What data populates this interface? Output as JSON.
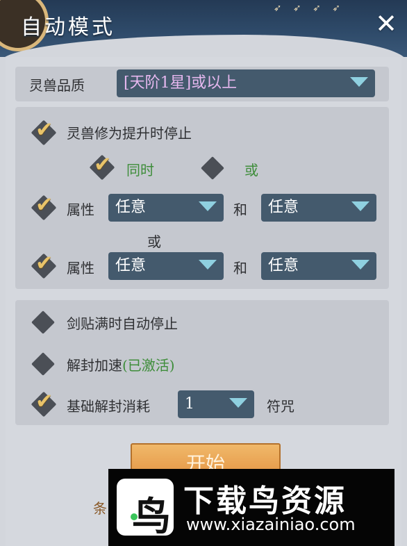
{
  "header": {
    "title": "自动模式",
    "close_symbol": "✕",
    "birds": "➶ ➶ ➶ ➶"
  },
  "quality": {
    "label": "灵兽品质",
    "value": "[天阶1星]或以上"
  },
  "cultivation": {
    "stop_label": "灵兽修为提升时停止",
    "both_label": "同时",
    "or_label": "或",
    "attr_label": "属性",
    "and_label": "和",
    "between_or": "或",
    "row1": {
      "attr1": "任意",
      "attr2": "任意"
    },
    "row2": {
      "attr1": "任意",
      "attr2": "任意"
    }
  },
  "options": {
    "sword_stop": "剑贴满时自动停止",
    "unseal_speed": "解封加速",
    "unseal_status": "(已激活)",
    "cost_label": "基础解封消耗",
    "cost_value": "1",
    "cost_unit": "符咒"
  },
  "footer": {
    "start_label": "开始",
    "condition_prefix": "条"
  },
  "watermark": {
    "brand": "下载鸟资源",
    "url": "www.xiazainiao.com",
    "logo_char": "鸟"
  },
  "colors": {
    "accent_gold": "#e8c36a",
    "dropdown_bg": "#445a6d",
    "green_text": "#3e8d3a",
    "quality_text": "#e7b8f0"
  }
}
